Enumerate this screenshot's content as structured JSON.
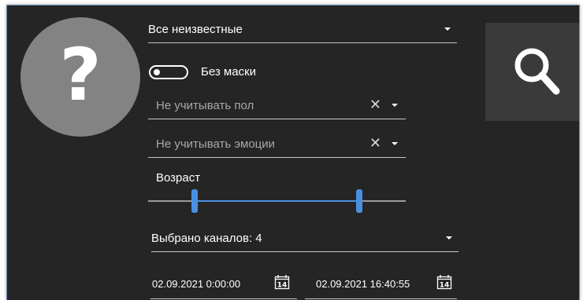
{
  "avatar": {
    "glyph": "?"
  },
  "identity_filter": {
    "value": "Все неизвестные"
  },
  "mask_toggle": {
    "label": "Без маски",
    "state": "off"
  },
  "gender_filter": {
    "placeholder": "Не учитывать пол"
  },
  "emotion_filter": {
    "placeholder": "Не учитывать эмоции"
  },
  "age_filter": {
    "label": "Возраст",
    "range_start_fraction": 0.18,
    "range_end_fraction": 0.82
  },
  "channels_filter": {
    "value": "Выбрано каналов: 4"
  },
  "date_from": {
    "value": "02.09.2021 0:00:00",
    "icon_day": "14"
  },
  "date_to": {
    "value": "02.09.2021 16:40:55",
    "icon_day": "14"
  },
  "search_button": {
    "icon": "search-icon"
  },
  "colors": {
    "panel": "#252526",
    "accent": "#4a90e2",
    "avatar": "#838383",
    "search_bg": "#3a3a3a"
  }
}
